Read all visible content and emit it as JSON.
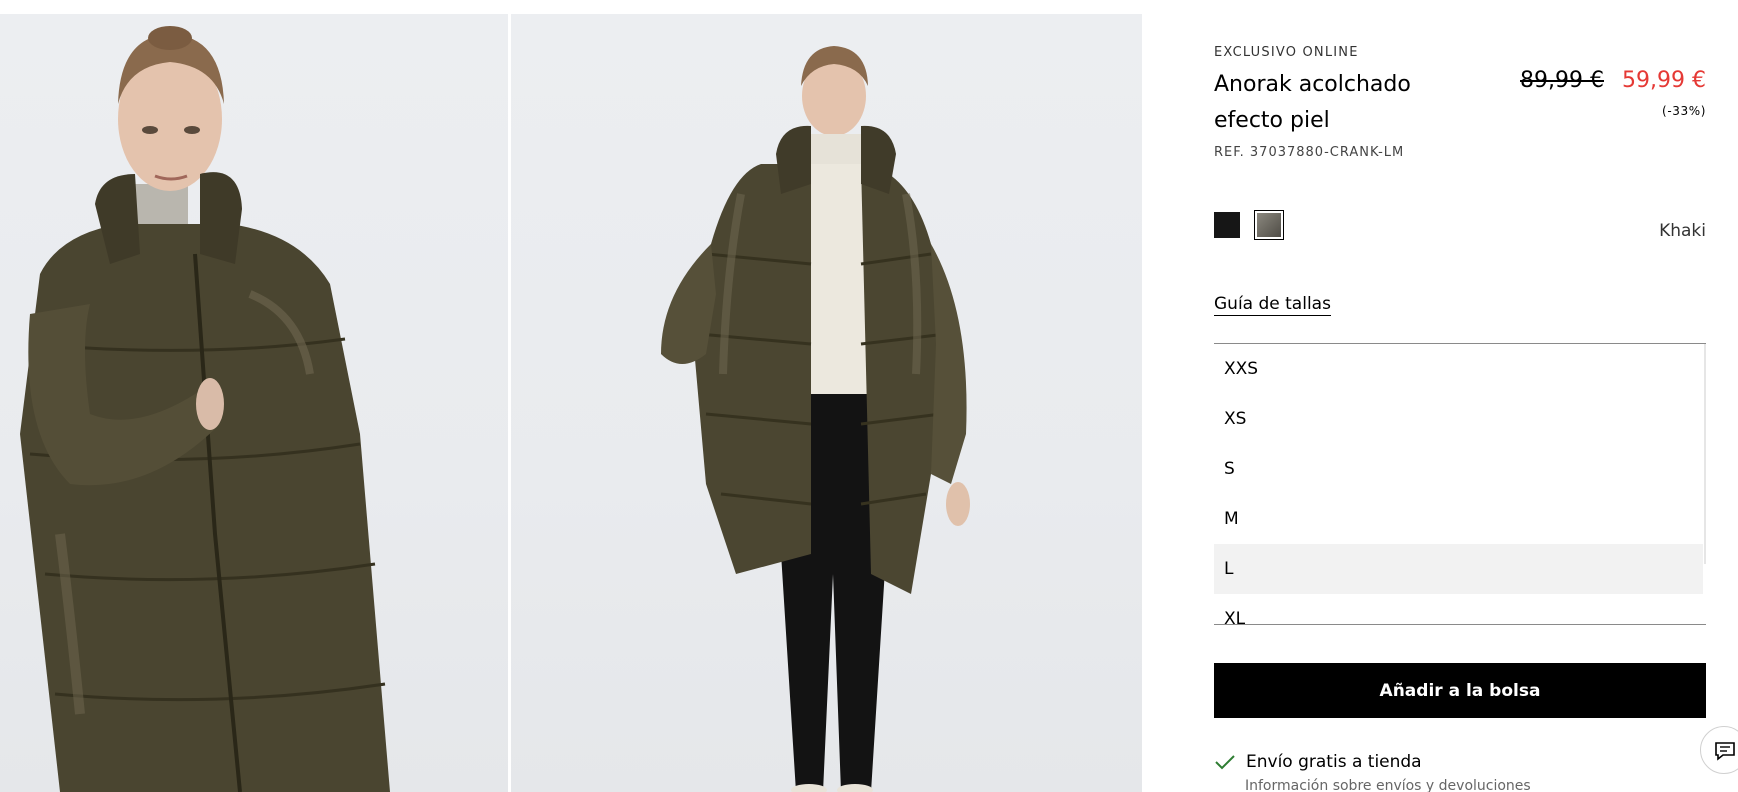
{
  "gallery": {
    "images": [
      {
        "name": "product-photo-front-closeup"
      },
      {
        "name": "product-photo-full-length"
      }
    ]
  },
  "product": {
    "badge": "EXCLUSIVO ONLINE",
    "title": "Anorak acolchado efecto piel",
    "price_old": "89,99 €",
    "price_new": "59,99 €",
    "discount": "(-33%)",
    "reference": "REF. 37037880-CRANK-LM",
    "colors": [
      {
        "name": "black",
        "hex": "#161616"
      },
      {
        "name": "khaki",
        "hex": "#6d6a62"
      }
    ],
    "selected_color": "Khaki",
    "size_guide": "Guía de tallas",
    "sizes": [
      "XXS",
      "XS",
      "S",
      "M",
      "L",
      "XL"
    ],
    "hovered_size": "L",
    "add_to_bag": "Añadir a la bolsa",
    "shipping": "Envío gratis a tienda",
    "shipping_info": "Información sobre envíos y devoluciones"
  },
  "colors": {
    "sale_red": "#e53935",
    "check_green": "#2e7d32",
    "button_black": "#000000"
  },
  "chat": {
    "icon": "chat-icon"
  }
}
